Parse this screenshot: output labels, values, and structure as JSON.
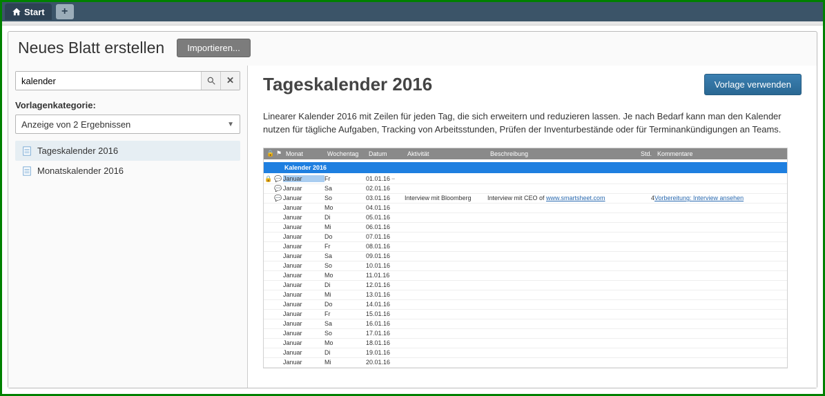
{
  "tabs": {
    "start": "Start"
  },
  "header": {
    "title": "Neues Blatt erstellen",
    "import_label": "Importieren..."
  },
  "sidebar": {
    "search_value": "kalender",
    "category_label": "Vorlagenkategorie:",
    "dropdown_selected": "Anzeige von 2 Ergebnissen",
    "results": [
      {
        "label": "Tageskalender 2016",
        "selected": true
      },
      {
        "label": "Monatskalender 2016",
        "selected": false
      }
    ]
  },
  "main": {
    "title": "Tageskalender 2016",
    "use_template_label": "Vorlage verwenden",
    "description": "Linearer Kalender 2016 mit Zeilen für jeden Tag, die sich erweitern und reduzieren lassen. Je nach Bedarf kann man den Kalender nutzen für tägliche Aufgaben, Tracking von Arbeitsstunden, Prüfen der Inventurbestände oder für Terminankündigungen an Teams."
  },
  "preview": {
    "columns": {
      "month": "Monat",
      "weekday": "Wochentag",
      "date": "Datum",
      "activity": "Aktivität",
      "description": "Beschreibung",
      "std": "Std.",
      "comments": "Kommentare"
    },
    "banner": "Kalender 2016",
    "rows": [
      {
        "month": "Januar",
        "wd": "Fr",
        "date": "01.01.16",
        "act": "",
        "desc": "",
        "std": "",
        "com": "",
        "hl": true,
        "lock": true
      },
      {
        "month": "Januar",
        "wd": "Sa",
        "date": "02.01.16",
        "act": "",
        "desc": "",
        "std": "",
        "com": ""
      },
      {
        "month": "Januar",
        "wd": "So",
        "date": "03.01.16",
        "act": "Interview mit Bloomberg",
        "desc_pre": "Interview mit CEO of ",
        "desc_link": "www.smartsheet.com",
        "std": "4",
        "com": "Vorbereitung: Interview ansehen"
      },
      {
        "month": "Januar",
        "wd": "Mo",
        "date": "04.01.16"
      },
      {
        "month": "Januar",
        "wd": "Di",
        "date": "05.01.16"
      },
      {
        "month": "Januar",
        "wd": "Mi",
        "date": "06.01.16"
      },
      {
        "month": "Januar",
        "wd": "Do",
        "date": "07.01.16"
      },
      {
        "month": "Januar",
        "wd": "Fr",
        "date": "08.01.16"
      },
      {
        "month": "Januar",
        "wd": "Sa",
        "date": "09.01.16"
      },
      {
        "month": "Januar",
        "wd": "So",
        "date": "10.01.16"
      },
      {
        "month": "Januar",
        "wd": "Mo",
        "date": "11.01.16"
      },
      {
        "month": "Januar",
        "wd": "Di",
        "date": "12.01.16"
      },
      {
        "month": "Januar",
        "wd": "Mi",
        "date": "13.01.16"
      },
      {
        "month": "Januar",
        "wd": "Do",
        "date": "14.01.16"
      },
      {
        "month": "Januar",
        "wd": "Fr",
        "date": "15.01.16"
      },
      {
        "month": "Januar",
        "wd": "Sa",
        "date": "16.01.16"
      },
      {
        "month": "Januar",
        "wd": "So",
        "date": "17.01.16"
      },
      {
        "month": "Januar",
        "wd": "Mo",
        "date": "18.01.16"
      },
      {
        "month": "Januar",
        "wd": "Di",
        "date": "19.01.16"
      },
      {
        "month": "Januar",
        "wd": "Mi",
        "date": "20.01.16"
      }
    ]
  }
}
